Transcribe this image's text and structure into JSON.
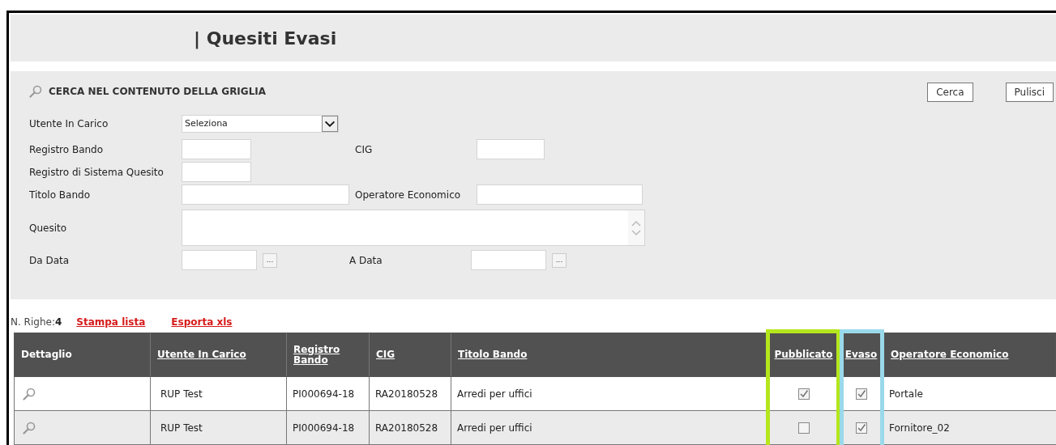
{
  "title": "| Quesiti Evasi",
  "search": {
    "heading": "CERCA NEL CONTENUTO DELLA GRIGLIA",
    "buttons": [
      "Cerca",
      "Pulisci"
    ],
    "utente_in_carico": {
      "label": "Utente In Carico",
      "value": "Seleziona"
    },
    "registro_bando": {
      "label": "Registro Bando"
    },
    "cig": {
      "label": "CIG"
    },
    "registro_sistema_quesito": {
      "label": "Registro di Sistema Quesito"
    },
    "titolo_bando": {
      "label": "Titolo Bando"
    },
    "operatore_economico": {
      "label": "Operatore Economico"
    },
    "quesito": {
      "label": "Quesito"
    },
    "da_data": {
      "label": "Da Data",
      "picker": "..."
    },
    "a_data": {
      "label": "A Data",
      "picker": "..."
    }
  },
  "list": {
    "count_label": "N. Righe:",
    "count": "4",
    "links": [
      "Stampa lista",
      "Esporta xls"
    ]
  },
  "table": {
    "columns": [
      {
        "label": "Dettaglio",
        "sortable": false
      },
      {
        "label": "Utente In Carico",
        "sortable": true
      },
      {
        "label": "Registro Bando",
        "sortable": true
      },
      {
        "label": "CIG",
        "sortable": true
      },
      {
        "label": "Titolo Bando",
        "sortable": true
      },
      {
        "label": "Pubblicato",
        "sortable": true,
        "color": "#b5e61d"
      },
      {
        "label": "Evaso",
        "sortable": true,
        "color": "#99d9ea"
      },
      {
        "label": "Operatore Economico",
        "sortable": true
      }
    ],
    "rows": [
      {
        "utente": "RUP Test",
        "registro": "PI000694-18",
        "cig": "RA20180528",
        "titolo": "Arredi per uffici",
        "pubblicato": true,
        "evaso": true,
        "operatore": "Portale"
      },
      {
        "utente": "RUP Test",
        "registro": "PI000694-18",
        "cig": "RA20180528",
        "titolo": "Arredi per uffici",
        "pubblicato": false,
        "evaso": true,
        "operatore": "Fornitore_02"
      }
    ]
  }
}
